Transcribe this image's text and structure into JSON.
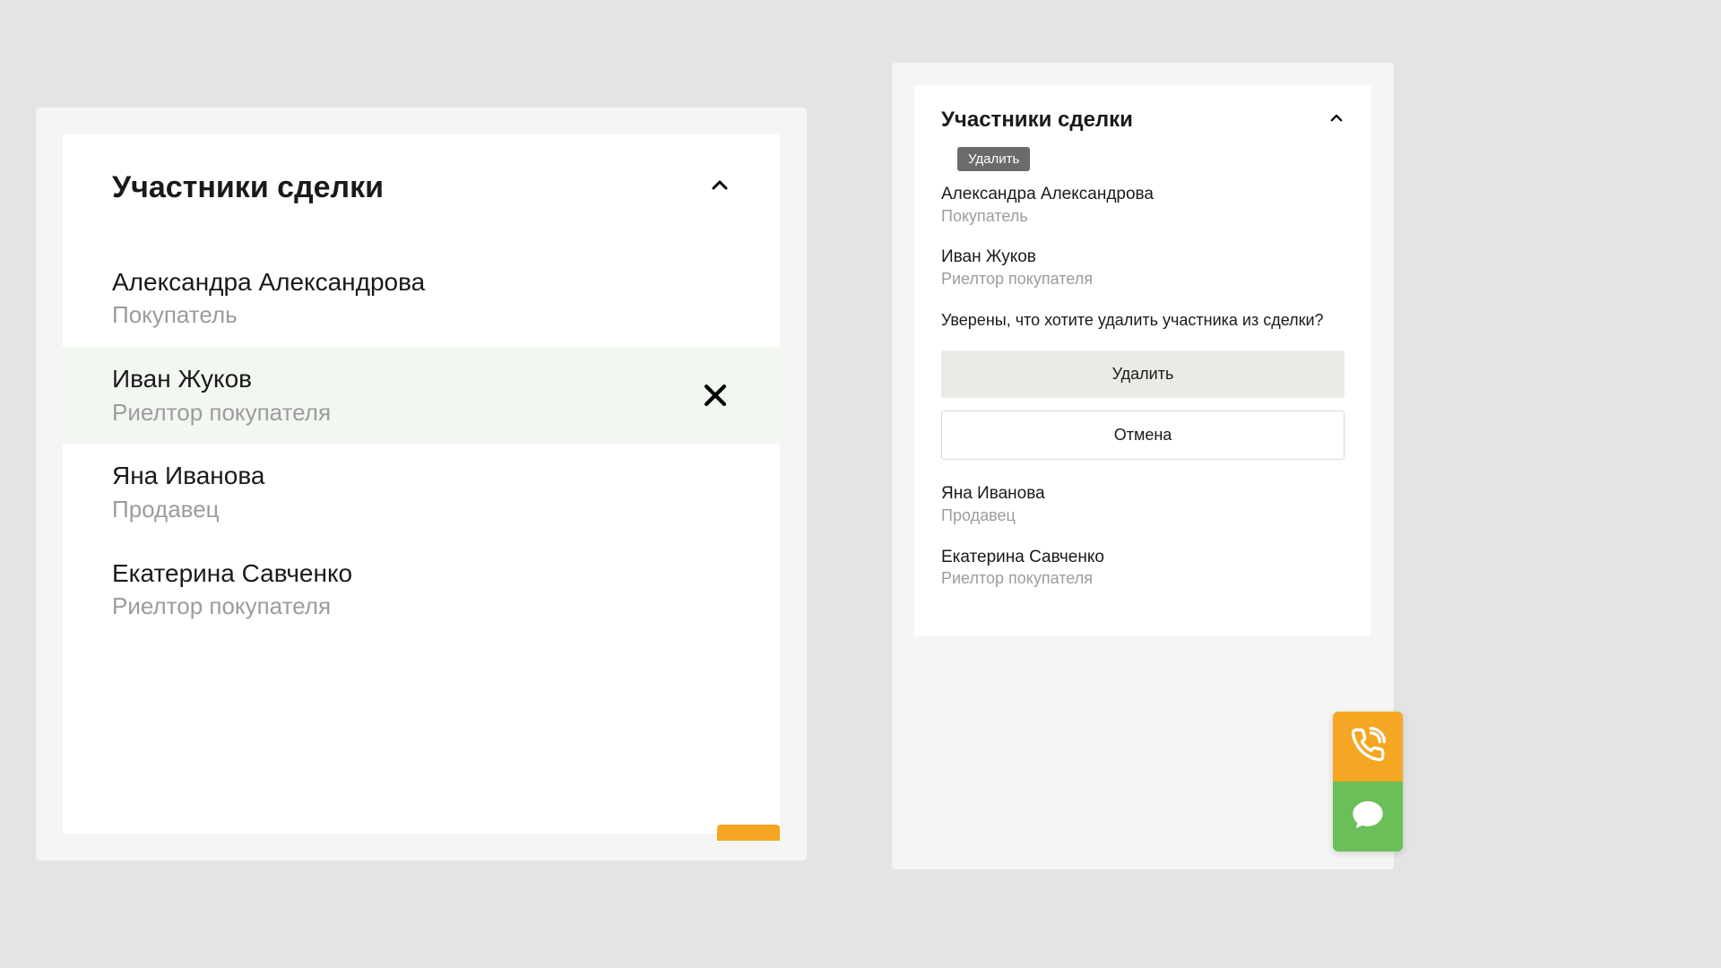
{
  "colors": {
    "accent_orange": "#f5a623",
    "accent_green": "#6bbf59",
    "hover_bg": "#f3f7f2",
    "text_muted": "#9c9c9c"
  },
  "left_panel": {
    "title": "Участники сделки",
    "participants": [
      {
        "name": "Александра Александрова",
        "role": "Покупатель"
      },
      {
        "name": "Иван Жуков",
        "role": "Риелтор покупателя"
      },
      {
        "name": "Яна Иванова",
        "role": "Продавец"
      },
      {
        "name": "Екатерина Савченко",
        "role": "Риелтор покупателя"
      }
    ],
    "hovered_index": 1
  },
  "right_panel": {
    "title": "Участники сделки",
    "tooltip": "Удалить",
    "participants_before": [
      {
        "name": "Александра Александрова",
        "role": "Покупатель"
      },
      {
        "name": "Иван Жуков",
        "role": "Риелтор покупателя"
      }
    ],
    "confirm_question": "Уверены, что хотите удалить участника из сделки?",
    "delete_button": "Удалить",
    "cancel_button": "Отмена",
    "participants_after": [
      {
        "name": "Яна Иванова",
        "role": "Продавец"
      },
      {
        "name": "Екатерина Савченко",
        "role": "Риелтор покупателя"
      }
    ]
  },
  "fab": {
    "call": "phone-icon",
    "chat": "chat-icon"
  }
}
